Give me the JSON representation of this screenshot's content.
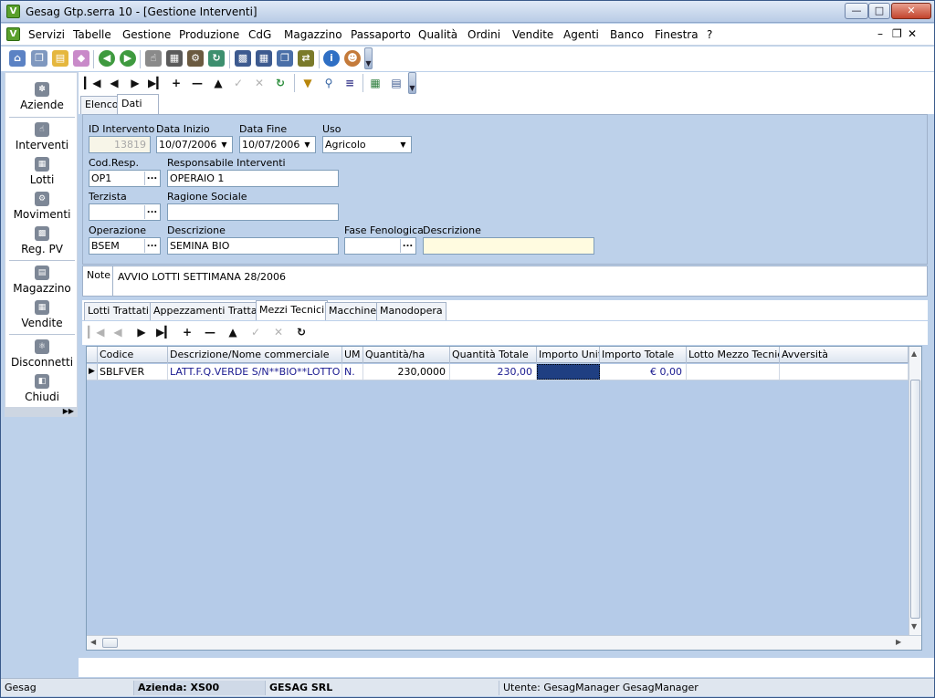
{
  "window": {
    "title": "Gesag Gtp.serra 10 - [Gestione Interventi]"
  },
  "menu": [
    "Servizi",
    "Tabelle",
    "Gestione",
    "Produzione",
    "CdG",
    "Magazzino",
    "Passaporto",
    "Qualità",
    "Ordini",
    "Vendite",
    "Agenti",
    "Banco",
    "Finestra",
    "?"
  ],
  "sidebar": {
    "items": [
      {
        "label": "Aziende",
        "icon": "gear-icon"
      },
      {
        "label": "Interventi",
        "icon": "hand-icon"
      },
      {
        "label": "Lotti",
        "icon": "box-icon"
      },
      {
        "label": "Movimenti",
        "icon": "truck-icon"
      },
      {
        "label": "Reg. PV",
        "icon": "register-icon"
      },
      {
        "label": "Magazzino",
        "icon": "warehouse-icon"
      },
      {
        "label": "Vendite",
        "icon": "calculator-icon"
      },
      {
        "label": "Disconnetti",
        "icon": "key-icon"
      },
      {
        "label": "Chiudi",
        "icon": "door-icon"
      }
    ]
  },
  "tabs": [
    "Elenco",
    "Dati"
  ],
  "form": {
    "id_intervento_label": "ID Intervento",
    "id_intervento": "13819",
    "data_inizio_label": "Data Inizio",
    "data_inizio": "10/07/2006",
    "data_fine_label": "Data Fine",
    "data_fine": "10/07/2006",
    "uso_label": "Uso",
    "uso": "Agricolo",
    "cod_resp_label": "Cod.Resp.",
    "cod_resp": "OP1",
    "responsabile_label": "Responsabile Interventi",
    "responsabile": "OPERAIO 1",
    "terzista_label": "Terzista",
    "terzista": "",
    "ragione_sociale_label": "Ragione Sociale",
    "ragione_sociale": "",
    "operazione_label": "Operazione",
    "operazione": "BSEM",
    "descrizione_label": "Descrizione",
    "descrizione": "SEMINA BIO",
    "fase_label": "Fase Fenologica",
    "fase": "",
    "descrizione2_label": "Descrizione",
    "descrizione2": ""
  },
  "notes": {
    "label": "Note",
    "value": "AVVIO LOTTI SETTIMANA 28/2006"
  },
  "subtabs": [
    "Lotti Trattati",
    "Appezzamenti Trattati",
    "Mezzi Tecnici",
    "Macchine",
    "Manodopera"
  ],
  "grid": {
    "columns": [
      "Codice",
      "Descrizione/Nome commerciale",
      "UM",
      "Quantità/ha",
      "Quantità Totale",
      "Importo Unit.",
      "Importo Totale",
      "Lotto Mezzo Tecnico",
      "Avversità"
    ],
    "rows": [
      [
        "SBLFVER",
        "LATT.F.Q.VERDE S/N**BIO**LOTTO",
        "N.",
        "230,0000",
        "230,00",
        "",
        "€ 0,00",
        "",
        ""
      ]
    ]
  },
  "status": {
    "app": "Gesag",
    "azienda": "Azienda: XS00",
    "ragione": "GESAG SRL",
    "utente": "Utente: GesagManager GesagManager"
  },
  "colors": {
    "form_bg": "#bdd1ea",
    "grid_bg": "#b5cbe8",
    "selected_cell": "#1f3f82",
    "grid_text": "#1a1a90"
  }
}
